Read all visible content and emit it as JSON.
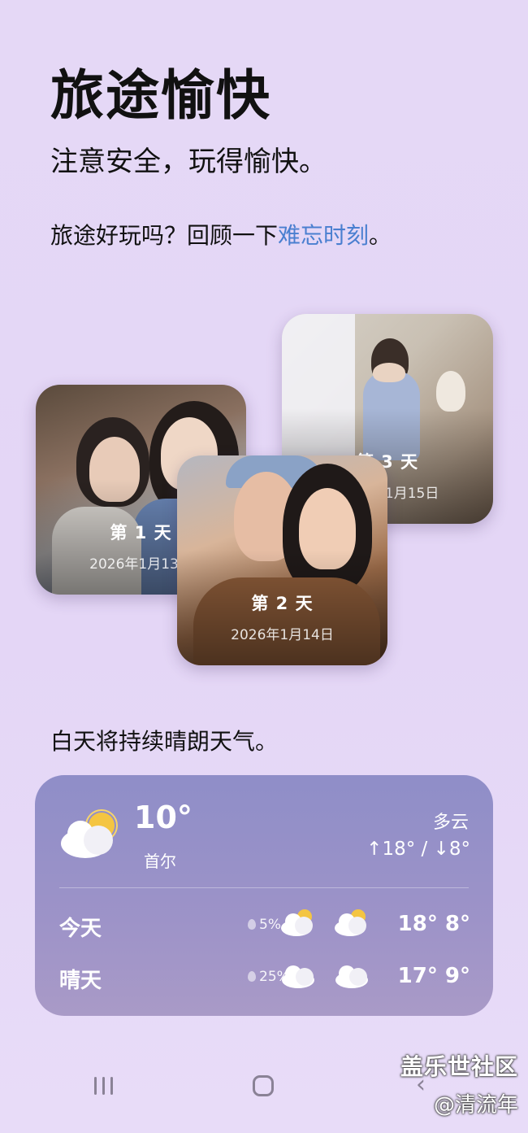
{
  "header": {
    "title": "旅途愉快",
    "subtitle": "注意安全，玩得愉快。",
    "prompt_prefix": "旅途好玩吗？回顾一下",
    "prompt_link": "难忘时刻",
    "prompt_suffix": "。"
  },
  "memories": [
    {
      "day": "第 1 天",
      "date": "2026年1月13日"
    },
    {
      "day": "第 2 天",
      "date": "2026年1月14日"
    },
    {
      "day": "第 3 天",
      "date": "2026年1月15日"
    }
  ],
  "weather": {
    "caption": "白天将持续晴朗天气。",
    "current_temp": "10°",
    "city": "首尔",
    "condition": "多云",
    "high_low": "↑18° / ↓8°",
    "current_icon": "partly-cloudy-icon",
    "forecast": [
      {
        "label": "今天",
        "precip": "5%",
        "temps": "18° 8°",
        "icons": [
          "partly-cloudy-icon",
          "partly-cloudy-icon"
        ]
      },
      {
        "label": "晴天",
        "precip": "25%",
        "temps": "17° 9°",
        "icons": [
          "cloud-icon",
          "cloud-icon"
        ]
      }
    ]
  },
  "watermark": {
    "line1": "盖乐世社区",
    "line2": "@清流年"
  },
  "colors": {
    "background": "#e5d8f6",
    "link": "#4a7fd0",
    "weather_card": "#9a93c8"
  }
}
